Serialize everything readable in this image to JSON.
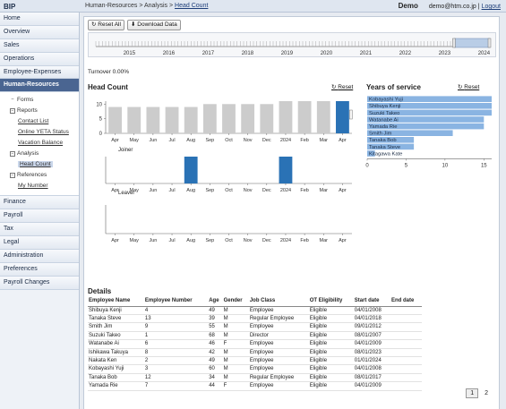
{
  "app": {
    "brand": "BIP"
  },
  "breadcrumb": {
    "part1": "Human-Resources",
    "sep": ">",
    "part2": "Analysis",
    "current": "Head Count"
  },
  "user": {
    "mode": "Demo",
    "email": "demo@htm.co.jp",
    "divider": "|",
    "logout": "Logout"
  },
  "sidebar": {
    "top_items": [
      "Home",
      "Overview",
      "Sales",
      "Operations",
      "Employee-Expenses"
    ],
    "active": "Human-Resources",
    "tree": {
      "forms": "Forms",
      "reports": "Reports",
      "contact_list": "Contact List",
      "online_status": "Online YETA Status",
      "vacation_balance": "Vacation Balance",
      "analysis": "Analysis",
      "head_count": "Head Count",
      "references": "References",
      "my_number": "My Number"
    },
    "bottom_items": [
      "Finance",
      "Payroll",
      "Tax",
      "Legal",
      "Administration",
      "Preferences",
      "Payroll Changes"
    ]
  },
  "toolbar": {
    "reset_all": "Reset All",
    "download": "Download Data"
  },
  "timeline": {
    "years": [
      "2015",
      "2016",
      "2017",
      "2018",
      "2019",
      "2020",
      "2021",
      "2022",
      "2023",
      "2024"
    ]
  },
  "turnover": "Turnover 0.00%",
  "headcount": {
    "title": "Head Count",
    "reset": "Reset",
    "joiner_title": "Joiner",
    "leaver_title": "Leaver"
  },
  "service": {
    "title": "Years of service",
    "reset": "Reset"
  },
  "chart_data": [
    {
      "type": "bar",
      "title": "Head Count",
      "categories": [
        "Apr",
        "May",
        "Jun",
        "Jul",
        "Aug",
        "Sep",
        "Oct",
        "Nov",
        "Dec",
        "2024",
        "Feb",
        "Mar",
        "Apr"
      ],
      "values": [
        9,
        9,
        9,
        9,
        9,
        10,
        10,
        10,
        10,
        11,
        11,
        11,
        11
      ],
      "highlight_index": 12,
      "ylim": [
        0,
        10
      ],
      "yticks": [
        0,
        5,
        10
      ],
      "colors": {
        "normal": "#cccccc",
        "selected": "#2a72b5"
      }
    },
    {
      "type": "bar",
      "title": "Joiner",
      "categories": [
        "Apr",
        "May",
        "Jun",
        "Jul",
        "Aug",
        "Sep",
        "Oct",
        "Nov",
        "Dec",
        "2024",
        "Feb",
        "Mar",
        "Apr"
      ],
      "values": [
        0,
        0,
        0,
        0,
        1,
        0,
        0,
        0,
        0,
        1,
        0,
        0,
        0
      ],
      "color": "#2a72b5"
    },
    {
      "type": "bar",
      "title": "Leaver",
      "categories": [
        "Apr",
        "May",
        "Jun",
        "Jul",
        "Aug",
        "Sep",
        "Oct",
        "Nov",
        "Dec",
        "2024",
        "Feb",
        "Mar",
        "Apr"
      ],
      "values": [
        0,
        0,
        0,
        0,
        0,
        0,
        0,
        0,
        0,
        0,
        0,
        0,
        0
      ],
      "color": "#2a72b5"
    },
    {
      "type": "bar",
      "orientation": "horizontal",
      "title": "Years of service",
      "categories": [
        "Kobayashi Yuji",
        "Shibuya Kenji",
        "Suzuki Takeo",
        "Watanabe Ai",
        "Yamada Rie",
        "Smith Jim",
        "Tanaka Bob",
        "Tanaka Steve",
        "Kitagawa Kate"
      ],
      "values": [
        16,
        16,
        16,
        15,
        15,
        11,
        6,
        6,
        1
      ],
      "xlim": [
        0,
        16
      ],
      "xticks": [
        0,
        5,
        10,
        15
      ],
      "color": "#8ab4e2"
    }
  ],
  "details": {
    "title": "Details",
    "columns": [
      "Employee Name",
      "Employee Number",
      "Age",
      "Gender",
      "Job Class",
      "OT Eligibility",
      "Start date",
      "End date"
    ],
    "rows": [
      [
        "Shibuya Kenji",
        "4",
        "49",
        "M",
        "Employee",
        "Eligible",
        "04/01/2008",
        ""
      ],
      [
        "Tanaka Steve",
        "13",
        "39",
        "M",
        "Regular Employee",
        "Eligible",
        "04/01/2018",
        ""
      ],
      [
        "Smith Jim",
        "9",
        "55",
        "M",
        "Employee",
        "Eligible",
        "09/01/2012",
        ""
      ],
      [
        "Suzuki Takeo",
        "1",
        "68",
        "M",
        "Director",
        "Eligible",
        "08/01/2007",
        ""
      ],
      [
        "Watanabe Ai",
        "6",
        "46",
        "F",
        "Employee",
        "Eligible",
        "04/01/2009",
        ""
      ],
      [
        "Ishikawa Takuya",
        "8",
        "42",
        "M",
        "Employee",
        "Eligible",
        "08/01/2023",
        ""
      ],
      [
        "Nakata Ken",
        "2",
        "49",
        "M",
        "Employee",
        "Eligible",
        "01/01/2024",
        ""
      ],
      [
        "Kobayashi Yuji",
        "3",
        "60",
        "M",
        "Employee",
        "Eligible",
        "04/01/2008",
        ""
      ],
      [
        "Tanaka Bob",
        "12",
        "34",
        "M",
        "Regular Employee",
        "Eligible",
        "08/01/2017",
        ""
      ],
      [
        "Yamada Rie",
        "7",
        "44",
        "F",
        "Employee",
        "Eligible",
        "04/01/2009",
        ""
      ]
    ]
  },
  "pager": {
    "pages": [
      "1",
      "2"
    ],
    "current": "1"
  }
}
